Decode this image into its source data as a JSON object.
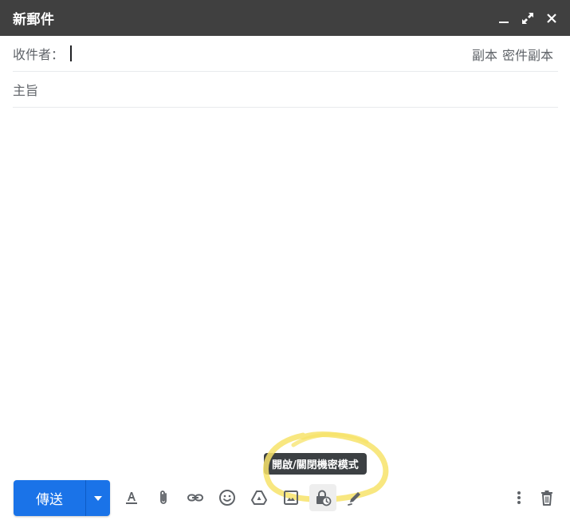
{
  "window": {
    "title": "新郵件"
  },
  "recipients": {
    "to_label": "收件者：",
    "to_value": "",
    "cc_label": "副本",
    "bcc_label": "密件副本"
  },
  "subject": {
    "placeholder": "主旨",
    "value": ""
  },
  "body": {
    "value": ""
  },
  "send": {
    "label": "傳送"
  },
  "tooltip": {
    "text": "開啟/關閉機密模式"
  },
  "toolbar": {
    "icons": [
      "format-text-icon",
      "attach-icon",
      "link-icon",
      "emoji-icon",
      "drive-icon",
      "photo-icon",
      "confidential-mode-icon",
      "signature-icon",
      "more-options-icon",
      "discard-draft-icon"
    ]
  },
  "colors": {
    "titlebar": "#404040",
    "send": "#1a73e8",
    "tooltip": "#3c4043",
    "highlight": "#f7e36a"
  }
}
